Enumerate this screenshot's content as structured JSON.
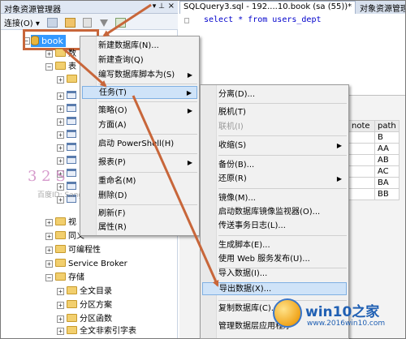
{
  "object_explorer": {
    "title": "对象资源管理器",
    "connect_label": "连接(O) ▾",
    "tree": [
      {
        "label": "book",
        "selected": true
      },
      {
        "label": "数"
      },
      {
        "label": "表"
      },
      {
        "label": "视"
      },
      {
        "label": "同义"
      },
      {
        "label": "可编程性"
      },
      {
        "label": "Service Broker"
      },
      {
        "label": "存储"
      },
      {
        "label": "全文目录"
      },
      {
        "label": "分区方案"
      },
      {
        "label": "分区函数"
      },
      {
        "label": "全文非索引字表"
      }
    ]
  },
  "editor": {
    "active_tab": "SQLQuery3.sql - 192....10.book (sa (55))*",
    "other_tab": "对象资源管理",
    "code_line": "select * from users_dept",
    "code_marker": "□"
  },
  "results_grid": {
    "columns": [
      "note",
      "path"
    ],
    "rows": [
      [
        "",
        "B"
      ],
      [
        "",
        "AA"
      ],
      [
        "",
        "AB"
      ],
      [
        "",
        "AC"
      ],
      [
        "",
        "BA"
      ],
      [
        "",
        "BB"
      ]
    ]
  },
  "context_menu": {
    "items": [
      {
        "label": "新建数据库(N)...",
        "submenu": false
      },
      {
        "label": "新建查询(Q)",
        "submenu": false
      },
      {
        "label": "编写数据库脚本为(S)",
        "submenu": true
      },
      {
        "label": "任务(T)",
        "submenu": true,
        "highlighted": true
      },
      {
        "label": "策略(O)",
        "submenu": true
      },
      {
        "label": "方面(A)",
        "submenu": false
      },
      {
        "label": "启动 PowerShell(H)",
        "submenu": false
      },
      {
        "label": "报表(P)",
        "submenu": true
      },
      {
        "label": "重命名(M)",
        "submenu": false
      },
      {
        "label": "删除(D)",
        "submenu": false
      },
      {
        "label": "刷新(F)",
        "submenu": false
      },
      {
        "label": "属性(R)",
        "submenu": false
      }
    ]
  },
  "tasks_submenu": {
    "items": [
      {
        "label": "分离(D)...",
        "submenu": false
      },
      {
        "label": "脱机(T)",
        "submenu": false
      },
      {
        "label": "联机(I)",
        "submenu": false,
        "disabled": true
      },
      {
        "label": "收缩(S)",
        "submenu": true
      },
      {
        "label": "备份(B)...",
        "submenu": false
      },
      {
        "label": "还原(R)",
        "submenu": true
      },
      {
        "label": "镜像(M)...",
        "submenu": false
      },
      {
        "label": "启动数据库镜像监视器(O)...",
        "submenu": false
      },
      {
        "label": "传送事务日志(L)...",
        "submenu": false
      },
      {
        "label": "生成脚本(E)...",
        "submenu": false
      },
      {
        "label": "使用 Web 服务发布(U)...",
        "submenu": false
      },
      {
        "label": "导入数据(I)...",
        "submenu": false
      },
      {
        "label": "导出数据(X)...",
        "submenu": false,
        "highlighted": true
      },
      {
        "label": "复制数据库(C)...",
        "submenu": false
      },
      {
        "label": "管理数据层应用程序",
        "submenu": false
      }
    ]
  },
  "watermark_left": {
    "big": "3 2 S",
    "small": "百度ID: Sangtt"
  },
  "watermark_right": {
    "title": "win10之家",
    "url": "www.2016win10.com"
  },
  "colors": {
    "selection": "#3399ff",
    "annotation": "#c8663a",
    "menu_highlight": "#cfe3f8"
  }
}
